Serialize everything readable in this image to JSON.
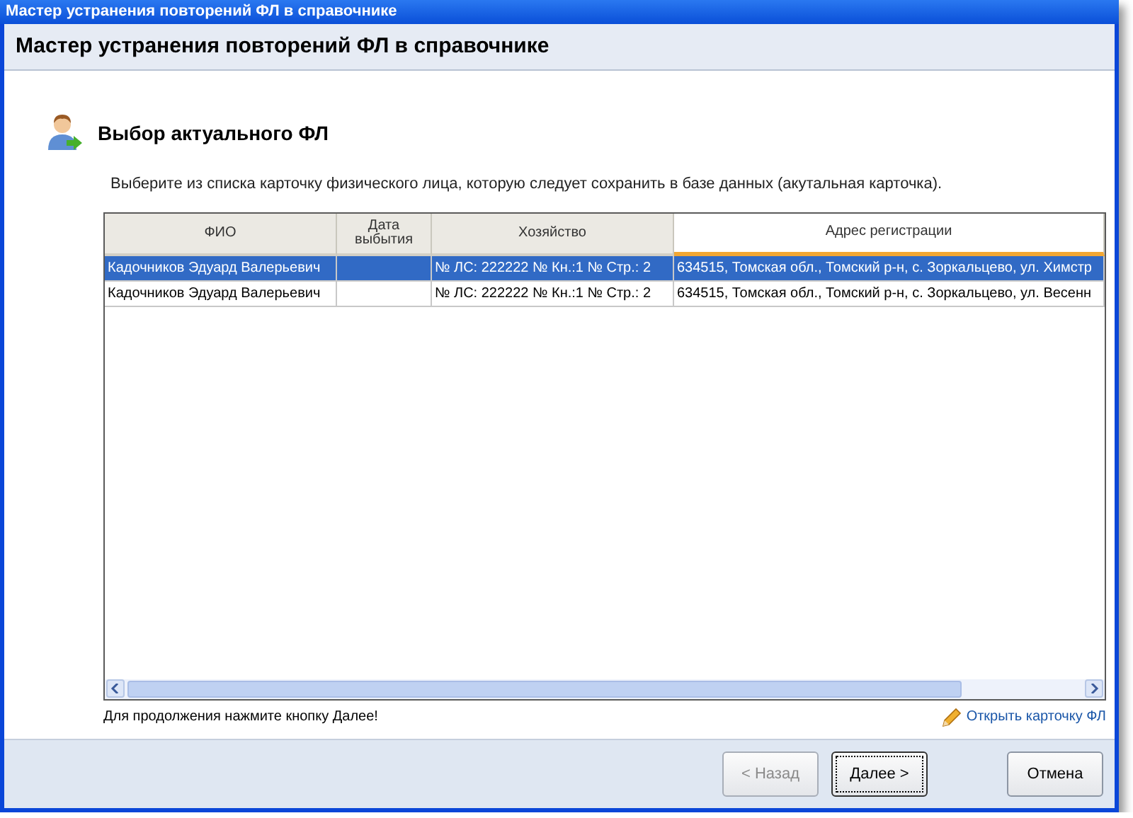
{
  "window": {
    "title": "Мастер устранения повторений ФЛ в справочнике"
  },
  "header": {
    "title": "Мастер устранения повторений ФЛ в справочнике"
  },
  "step": {
    "title": "Выбор актуального ФЛ",
    "description": "Выберите из списка карточку физического лица, которую следует сохранить в базе данных (акутальная карточка)."
  },
  "table": {
    "columns": [
      {
        "label": "ФИО",
        "hot": false
      },
      {
        "label": "Дата выбытия",
        "hot": false
      },
      {
        "label": "Хозяйство",
        "hot": false
      },
      {
        "label": "Адрес регистрации",
        "hot": true
      }
    ],
    "rows": [
      {
        "selected": true,
        "cells": [
          "Кадочников Эдуард Валерьевич",
          "",
          "№ ЛС: 222222 № Кн.:1 № Стр.: 2",
          "634515, Томская обл., Томский р-н, с. Зоркальцево, ул. Химстр"
        ]
      },
      {
        "selected": false,
        "cells": [
          "Кадочников Эдуард Валерьевич",
          "",
          "№ ЛС: 222222 № Кн.:1 № Стр.: 2",
          "634515, Томская обл., Томский р-н, с. Зоркальцево, ул. Весенн"
        ]
      }
    ]
  },
  "hint": "Для продолжения нажмите кнопку Далее!",
  "open_link": "Открыть карточку ФЛ",
  "buttons": [
    {
      "label": "< Назад",
      "disabled": true,
      "default": false
    },
    {
      "label": "Далее >",
      "disabled": false,
      "default": true
    },
    {
      "label": "Отмена",
      "disabled": false,
      "default": false
    }
  ]
}
